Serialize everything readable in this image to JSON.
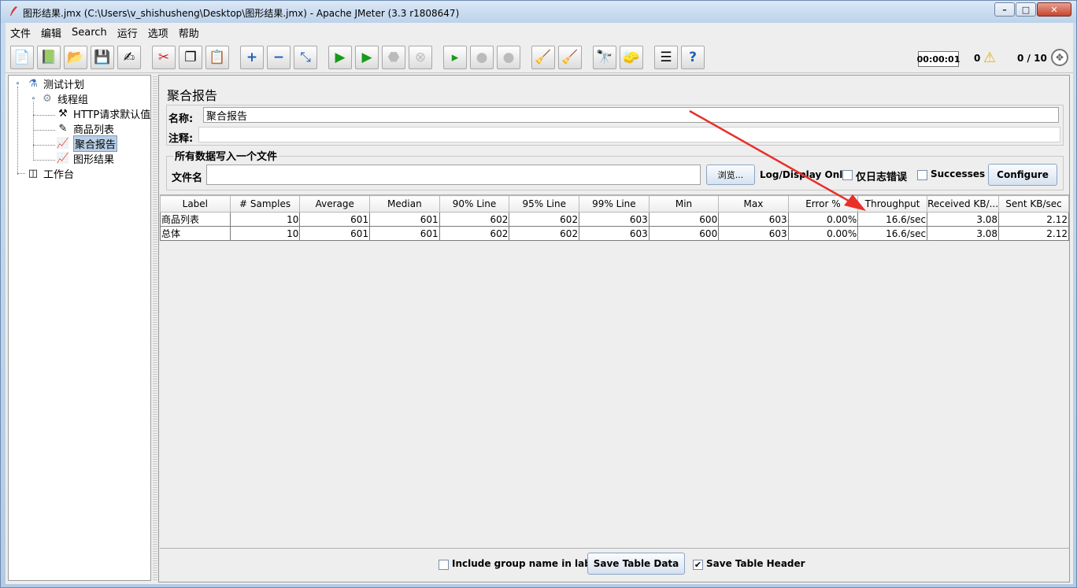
{
  "window": {
    "title": "图形结果.jmx (C:\\Users\\v_shishusheng\\Desktop\\图形结果.jmx) - Apache JMeter (3.3 r1808647)",
    "minimize": "–",
    "maximize": "□",
    "close": "✕"
  },
  "menu": [
    "文件",
    "编辑",
    "Search",
    "运行",
    "选项",
    "帮助"
  ],
  "toolbar": {
    "timer": "00:00:01",
    "warnings": "0",
    "threads": "0 / 10"
  },
  "tree": {
    "plan": "测试计划",
    "thread_group": "线程组",
    "http_defaults": "HTTP请求默认值",
    "product_list": "商品列表",
    "aggregate_report": "聚合报告",
    "graph_results": "图形结果",
    "workbench": "工作台"
  },
  "panel": {
    "title": "聚合报告",
    "name_label": "名称:",
    "name_value": "聚合报告",
    "comment_label": "注释:",
    "comment_value": "",
    "file_group_title": "所有数据写入一个文件",
    "file_label": "文件名",
    "file_value": "",
    "browse_button": "浏览...",
    "log_display_only": "Log/Display Only:",
    "errors_only": "仅日志错误",
    "successes": "Successes",
    "configure": "Configure"
  },
  "table": {
    "columns": [
      "Label",
      "# Samples",
      "Average",
      "Median",
      "90% Line",
      "95% Line",
      "99% Line",
      "Min",
      "Max",
      "Error %",
      "Throughput",
      "Received KB/...",
      "Sent KB/sec"
    ],
    "rows": [
      [
        "商品列表",
        "10",
        "601",
        "601",
        "602",
        "602",
        "603",
        "600",
        "603",
        "0.00%",
        "16.6/sec",
        "3.08",
        "2.12"
      ],
      [
        "总体",
        "10",
        "601",
        "601",
        "602",
        "602",
        "603",
        "600",
        "603",
        "0.00%",
        "16.6/sec",
        "3.08",
        "2.12"
      ]
    ]
  },
  "bottom": {
    "include_group": "Include group name in label?",
    "save_table_data": "Save Table Data",
    "save_table_header": "Save Table Header"
  },
  "colors": {
    "annotation_arrow": "#e8302a",
    "selection": "#b8cfe5"
  }
}
